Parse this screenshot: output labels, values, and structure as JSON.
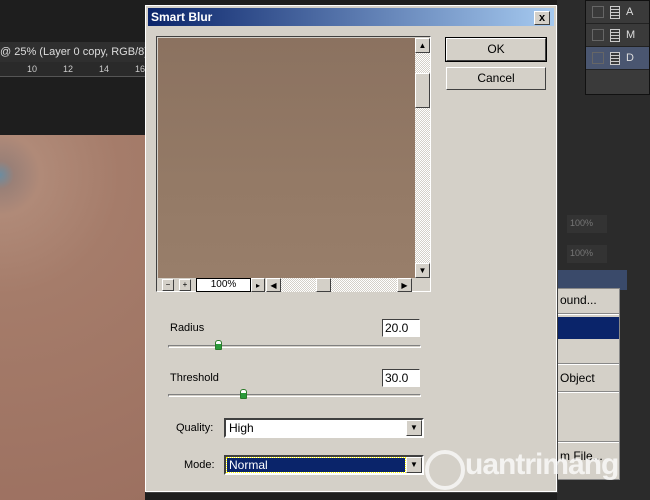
{
  "document": {
    "tab_title": "@ 25% (Layer 0 copy, RGB/8)",
    "ruler_ticks": [
      "10",
      "12",
      "14",
      "16"
    ]
  },
  "layers_panel": {
    "items": [
      {
        "label": "A"
      },
      {
        "label": "M"
      },
      {
        "label": "D",
        "selected": true
      }
    ],
    "opacity": "100%",
    "fill": "100%"
  },
  "context_menu": {
    "items": [
      "ound...",
      "",
      "",
      "Object",
      "",
      "",
      "m File..."
    ],
    "selected_index": 1
  },
  "dialog": {
    "title": "Smart Blur",
    "close_label": "x",
    "ok_label": "OK",
    "cancel_label": "Cancel",
    "preview": {
      "zoom": "100%",
      "zoom_out": "−",
      "zoom_in": "+"
    },
    "radius": {
      "label": "Radius",
      "value": "20.0",
      "fraction": 0.2
    },
    "threshold": {
      "label": "Threshold",
      "value": "30.0",
      "fraction": 0.3
    },
    "quality": {
      "label": "Quality:",
      "value": "High"
    },
    "mode": {
      "label": "Mode:",
      "value": "Normal"
    }
  },
  "watermark": "uantrimang"
}
